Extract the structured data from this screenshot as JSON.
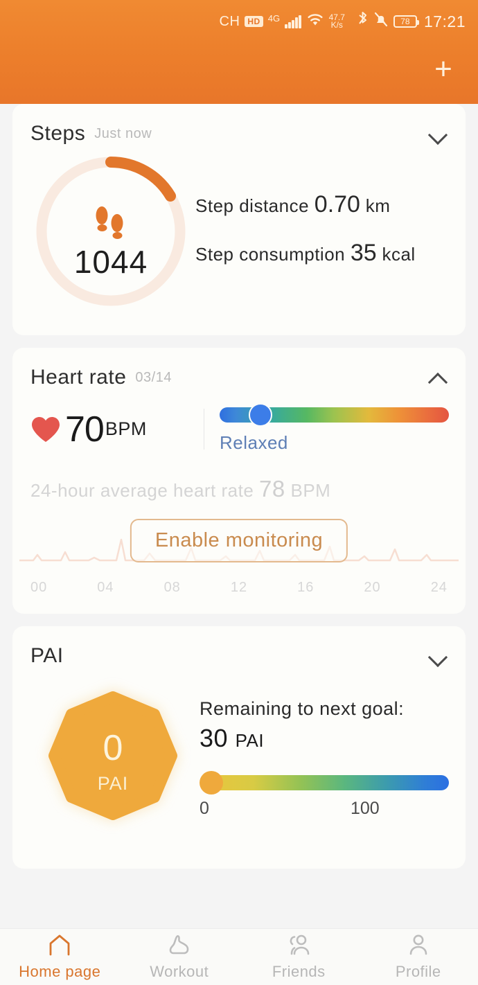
{
  "statusbar": {
    "carrier": "CH",
    "network_badge": "HD",
    "network_type": "4G",
    "signal_icon": "signal-bars-icon",
    "wifi_icon": "wifi-icon",
    "data_speed": "47.7",
    "data_speed_unit": "K/s",
    "bluetooth_icon": "bluetooth-icon",
    "mute_icon": "bell-muted-icon",
    "battery_level": "78",
    "time": "17:21"
  },
  "header": {
    "add_icon": "plus-icon",
    "add_label": "+",
    "accent_color": "#EC7E2B"
  },
  "cards": {
    "steps": {
      "title": "Steps",
      "subtitle": "Just now",
      "chevron_icon": "chevron-down-icon",
      "collapsed": true,
      "footprint_icon": "footprints-icon",
      "count": "1044",
      "progress_percent": 18,
      "ring_track_color": "#F7E6DC",
      "ring_fill_color": "#E2772C",
      "stats": [
        {
          "label": "Step distance",
          "value": "0.70",
          "unit": "km"
        },
        {
          "label": "Step consumption",
          "value": "35",
          "unit": "kcal"
        }
      ]
    },
    "heart_rate": {
      "title": "Heart rate",
      "subtitle": "03/14",
      "chevron_icon": "chevron-up-icon",
      "collapsed": false,
      "heart_icon": "heart-icon",
      "heart_color": "#E4564E",
      "bpm_value": "70",
      "bpm_unit": "BPM",
      "zone_state": "Relaxed",
      "zone_state_color": "#5E7FB5",
      "zone_thumb_position_percent": 13,
      "average_prefix": "24-hour average heart rate",
      "average_value": "78",
      "average_unit": "BPM",
      "enable_button": "Enable monitoring",
      "enable_button_color": "#C98B4E",
      "axis_labels": [
        "00",
        "04",
        "08",
        "12",
        "16",
        "20",
        "24"
      ]
    },
    "pai": {
      "title": "PAI",
      "chevron_icon": "chevron-down-icon",
      "collapsed": true,
      "badge_value": "0",
      "badge_label": "PAI",
      "badge_color": "#EFA93C",
      "goal_label": "Remaining to next goal:",
      "goal_value": "30",
      "goal_unit": "PAI",
      "slider_min": "0",
      "slider_max": "100",
      "slider_thumb_position_percent": 0,
      "slider_thumb_color": "#EFA93C"
    }
  },
  "bottom_nav": [
    {
      "label": "Home page",
      "icon": "home-icon",
      "active": true
    },
    {
      "label": "Workout",
      "icon": "shoe-icon",
      "active": false
    },
    {
      "label": "Friends",
      "icon": "friends-icon",
      "active": false
    },
    {
      "label": "Profile",
      "icon": "person-icon",
      "active": false
    }
  ]
}
